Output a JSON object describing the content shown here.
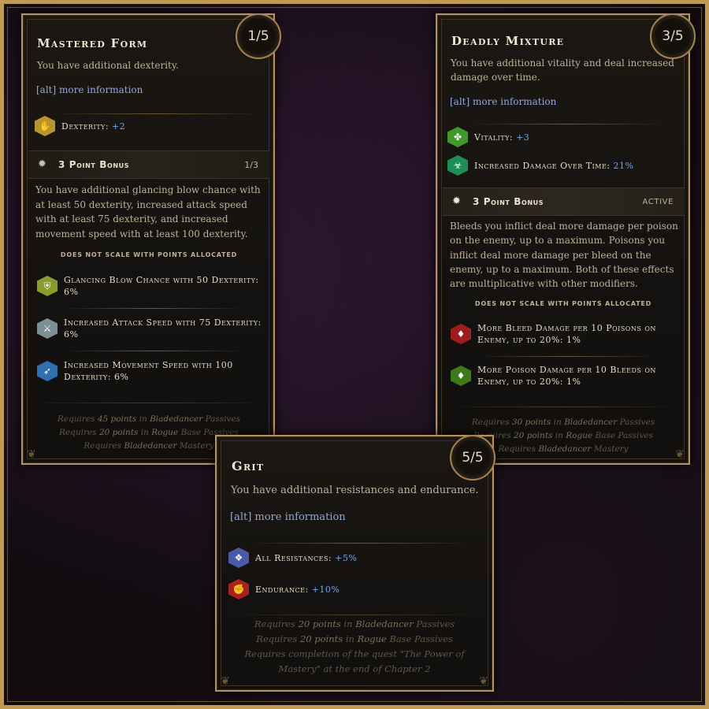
{
  "panels": {
    "mastered_form": {
      "title": "Mastered Form",
      "points": "1/5",
      "description": "You have additional dexterity.",
      "alt_text": "[alt] more information",
      "stats": [
        {
          "label": "Dexterity:",
          "value": "+2",
          "icon": "dexterity-icon",
          "color": "#b8942c"
        }
      ],
      "bonus": {
        "label": "3 Point Bonus",
        "status": "1/3",
        "description": "You have additional glancing blow chance with at least 50 dexterity, increased attack speed with at least 75 dexterity, and increased movement speed with at least 100 dexterity.",
        "no_scale": "Does not scale with points allocated",
        "stats": [
          {
            "line1": "Glancing Blow Chance with 50 Dexterity:",
            "line2": "6%",
            "icon": "glancing-blow-icon",
            "color": "#8a9a2c"
          },
          {
            "line1": "Increased Attack Speed with 75 Dexterity:",
            "line2": "6%",
            "icon": "attack-speed-icon",
            "color": "#7c8f94"
          },
          {
            "line1": "Increased Movement Speed with 100",
            "line2": "Dexterity: 6%",
            "icon": "movement-speed-icon",
            "color": "#2e6fae"
          }
        ]
      },
      "requirements": [
        {
          "a": "Requires ",
          "b": "45 points",
          "c": " in ",
          "d": "Bladedancer",
          "e": " Passives"
        },
        {
          "a": "Requires ",
          "b": "20 points",
          "c": " in ",
          "d": "Rogue",
          "e": " Base Passives"
        },
        {
          "a": "Requires ",
          "b": "Bladedancer",
          "c": " Mastery",
          "d": "",
          "e": ""
        }
      ]
    },
    "deadly_mixture": {
      "title": "Deadly Mixture",
      "points": "3/5",
      "description": "You have additional vitality and deal increased damage over time.",
      "alt_text": "[alt] more information",
      "stats": [
        {
          "label": "Vitality:",
          "value": "+3",
          "icon": "vitality-icon",
          "color": "#3f9a2a"
        },
        {
          "label": "Increased Damage Over Time:",
          "value": "21%",
          "icon": "damage-over-time-icon",
          "color": "#1f8e55"
        }
      ],
      "bonus": {
        "label": "3 Point Bonus",
        "status": "Active",
        "description": "Bleeds you inflict deal more damage per poison on the enemy, up to a maximum. Poisons you inflict deal more damage per bleed on the enemy, up to a maximum. Both of these effects are multiplicative with other modifiers.",
        "no_scale": "Does not scale with points allocated",
        "stats": [
          {
            "line1": "More Bleed Damage per 10 Poisons on",
            "line2": "Enemy, up to 20%: 1%",
            "icon": "bleed-damage-icon",
            "color": "#9e1e1e"
          },
          {
            "line1": "More Poison Damage per 10 Bleeds on",
            "line2": "Enemy, up to 20%: 1%",
            "icon": "poison-damage-icon",
            "color": "#3c7a1c"
          }
        ]
      },
      "requirements": [
        {
          "a": "Requires ",
          "b": "30 points",
          "c": " in ",
          "d": "Bladedancer",
          "e": " Passives"
        },
        {
          "a": "Requires ",
          "b": "20 points",
          "c": " in ",
          "d": "Rogue",
          "e": " Base Passives"
        },
        {
          "a": "Requires ",
          "b": "Bladedancer",
          "c": " Mastery",
          "d": "",
          "e": ""
        }
      ]
    },
    "grit": {
      "title": "Grit",
      "points": "5/5",
      "description": "You have additional resistances and endurance.",
      "alt_text": "[alt] more information",
      "stats": [
        {
          "label": "All Resistances:",
          "value": "+5%",
          "icon": "all-resistances-icon",
          "color": "#4a5aa8"
        },
        {
          "label": "Endurance:",
          "value": "+10%",
          "icon": "endurance-icon",
          "color": "#a82222"
        }
      ],
      "requirements": [
        {
          "a": "Requires ",
          "b": "20 points",
          "c": " in ",
          "d": "Bladedancer",
          "e": " Passives"
        },
        {
          "a": "Requires ",
          "b": "20 points",
          "c": " in ",
          "d": "Rogue",
          "e": " Base Passives"
        }
      ],
      "quest_req_1": "Requires completion of the quest \"The Power of",
      "quest_req_2": "Mastery\" at the end of Chapter 2"
    }
  }
}
